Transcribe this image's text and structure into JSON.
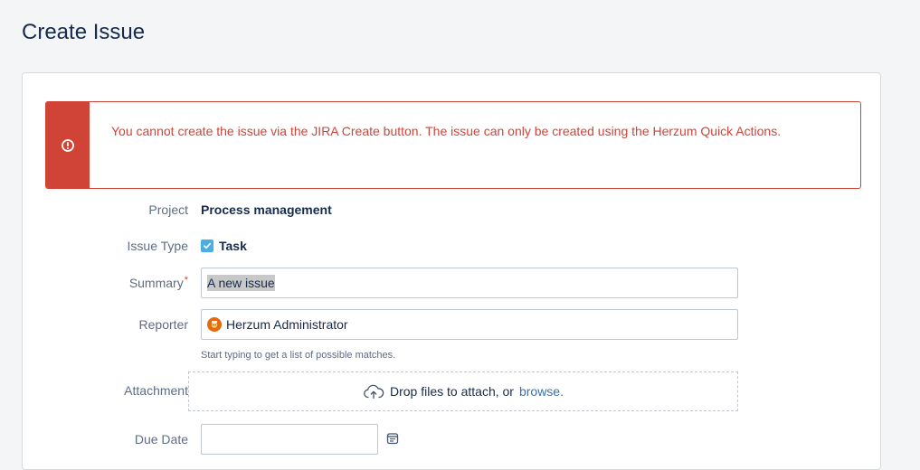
{
  "page": {
    "title": "Create Issue"
  },
  "error": {
    "message": "You cannot create the issue via the JIRA Create button. The issue can only be created using the Herzum Quick Actions.",
    "icon": "error-icon",
    "color": "#d04437"
  },
  "fields": {
    "project": {
      "label": "Project",
      "value": "Process management"
    },
    "issue_type": {
      "label": "Issue Type",
      "value": "Task",
      "icon": "task-checkbox-icon"
    },
    "summary": {
      "label": "Summary",
      "required_marker": "*",
      "value": "A new issue"
    },
    "reporter": {
      "label": "Reporter",
      "value": "Herzum Administrator",
      "hint": "Start typing to get a list of possible matches."
    },
    "attachment": {
      "label": "Attachment",
      "drop_text": "Drop files to attach, or",
      "browse_link": "browse."
    },
    "due_date": {
      "label": "Due Date",
      "value": ""
    }
  },
  "colors": {
    "accent_link": "#3572b0",
    "task_icon": "#4bade8",
    "avatar": "#e56910"
  }
}
